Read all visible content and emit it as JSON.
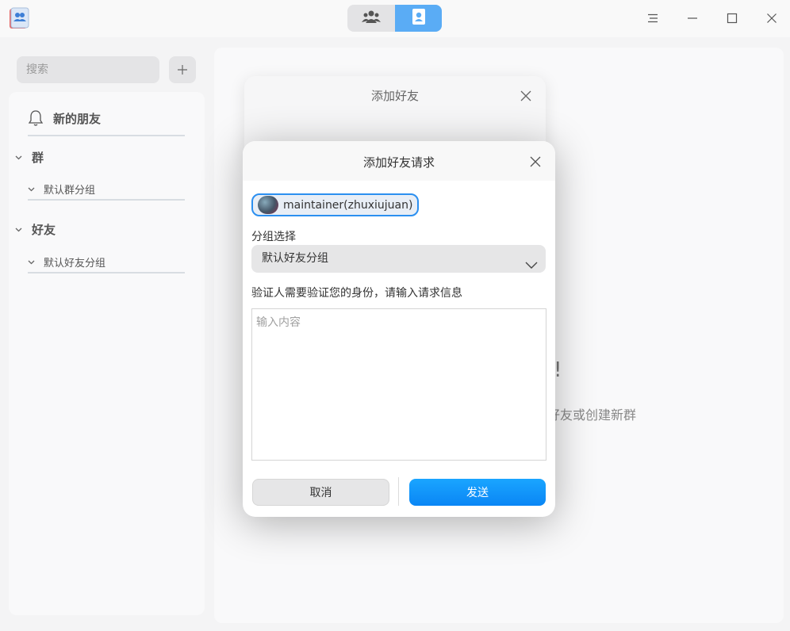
{
  "toolbar": {
    "tabs": [
      {
        "icon": "group-icon",
        "active": false
      },
      {
        "icon": "contact-card-icon",
        "active": true
      }
    ]
  },
  "sidebar": {
    "search_placeholder": "搜索",
    "new_friends": "新的朋友",
    "groups_header": "群",
    "groups_default": "默认群分组",
    "friends_header": "好友",
    "friends_default": "默认好友分组"
  },
  "main": {
    "bg_text1": "!",
    "bg_text2": "好友或创建新群"
  },
  "back_dialog": {
    "title": "添加好友"
  },
  "dialog": {
    "title": "添加好友请求",
    "user_chip": "maintainer(zhuxiujuan)",
    "group_label": "分组选择",
    "group_value": "默认好友分组",
    "verify_label": "验证人需要验证您的身份，请输入请求信息",
    "textarea_placeholder": "输入内容",
    "textarea_value": "",
    "cancel_label": "取消",
    "send_label": "发送"
  },
  "colors": {
    "accent": "#0a92f8",
    "tab_active": "#5aacf5"
  }
}
